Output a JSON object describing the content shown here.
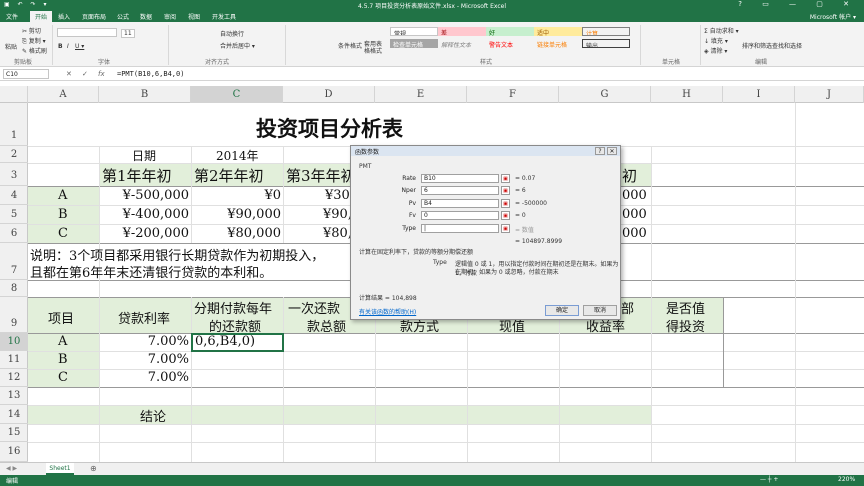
{
  "window": {
    "title": "4.5.7 项目投资分析表原始文件.xlsx - Microsoft Excel",
    "qa": "▣ ↶ ↷ ▾",
    "controls": "? ▭ — ▢ ✕"
  },
  "tabs": [
    "文件",
    "开始",
    "插入",
    "页面布局",
    "公式",
    "数据",
    "审阅",
    "视图",
    "开发工具"
  ],
  "account": "Microsoft 帐户 ▾",
  "ribbon": {
    "paste": "粘贴",
    "cut": "✂ 剪切",
    "copy": "⎘ 复制 ▾",
    "painter": "✎ 格式刷",
    "clipboard": "剪贴板",
    "font_size": "11",
    "bold": "B",
    "italic": "I",
    "underline": "U ▾",
    "font": "字体",
    "wrap": "自动换行",
    "merge": "合并后居中 ▾",
    "align": "对齐方式",
    "cond": "条件格式",
    "table": "套用表格格式",
    "styles_label": "样式",
    "style_boxes": [
      "常规",
      "差",
      "好",
      "适中",
      "计算",
      "检查单元格",
      "解释性文本",
      "警告文本",
      "链接单元格",
      "输出"
    ],
    "cells": "单元格",
    "autosum": "Σ 自动求和 ▾",
    "fill": "↓ 填充 ▾",
    "clear": "◈ 清除 ▾",
    "sort": "排序和筛选",
    "find": "查找和选择",
    "edit": "编辑"
  },
  "formula_bar": {
    "name_box": "C10",
    "cancel": "✕",
    "enter": "✓",
    "fx": "fx",
    "formula": "=PMT(B10,6,B4,0)"
  },
  "columns": [
    "A",
    "B",
    "C",
    "D",
    "E",
    "F",
    "G",
    "H",
    "I",
    "J"
  ],
  "rows": [
    "1",
    "2",
    "3",
    "4",
    "5",
    "6",
    "7",
    "8",
    "9",
    "10",
    "11",
    "12",
    "13",
    "14",
    "15",
    "16"
  ],
  "sheet": {
    "title": "投资项目分析表",
    "r2_b": "日期",
    "r2_c": "2014年",
    "r3": [
      "第1年年初",
      "第2年年初",
      "第3年年初",
      "初"
    ],
    "r4": [
      "A",
      "¥-500,000",
      "¥0",
      "¥300,",
      "000"
    ],
    "r5": [
      "B",
      "¥-400,000",
      "¥90,000",
      "¥90,",
      "000"
    ],
    "r6": [
      "C",
      "¥-200,000",
      "¥80,000",
      "¥80,",
      "000"
    ],
    "note1": "说明：3个项目都采用银行长期贷款作为初期投入，",
    "note2": "且都在第6年年末还清银行贷款的本利和。",
    "h9_a": "项目",
    "h9_b": "贷款利率",
    "h9_c1": "分期付款每年",
    "h9_c2": "的还款额",
    "h9_d1": "一次还款",
    "h9_d2": "款总额",
    "h9_e2": "款方式",
    "h9_f2": "现值",
    "h9_g1": "部",
    "h9_g2": "收益率",
    "h9_h1": "是否值",
    "h9_h2": "得投资",
    "r10": [
      "A",
      "7.00%",
      "0,6,B4,0)"
    ],
    "r11": [
      "B",
      "7.00%"
    ],
    "r12": [
      "C",
      "7.00%"
    ],
    "conclusion": "结论"
  },
  "dialog": {
    "title": "函数参数",
    "help_btn": "?",
    "close_btn": "✕",
    "func": "PMT",
    "args": [
      {
        "label": "Rate",
        "value": "B10",
        "result": "= 0.07"
      },
      {
        "label": "Nper",
        "value": "6",
        "result": "= 6"
      },
      {
        "label": "Pv",
        "value": "B4",
        "result": "= -500000"
      },
      {
        "label": "Fv",
        "value": "0",
        "result": "= 0"
      },
      {
        "label": "Type",
        "value": "|",
        "result": "= 数值"
      }
    ],
    "total": "= 104897.8999",
    "desc": "计算在固定利率下，贷款的等额分期偿还额",
    "type_label": "Type",
    "type_desc1": "逻辑值 0 或 1，用以指定付款时间在期初还是在期末。如果为 1，付款",
    "type_desc2": "在期初；如果为 0 或忽略，付款在期末",
    "result": "计算结果 =  104,898",
    "help_link": "有关该函数的帮助(H)",
    "ok": "确定",
    "cancel": "取消"
  },
  "sheet_tab": "Sheet1",
  "add_sheet": "⊕",
  "status": {
    "mode": "编辑",
    "zoom": "220%"
  },
  "colors": {
    "excel_green": "#217346",
    "cell_green": "#e2efda"
  }
}
